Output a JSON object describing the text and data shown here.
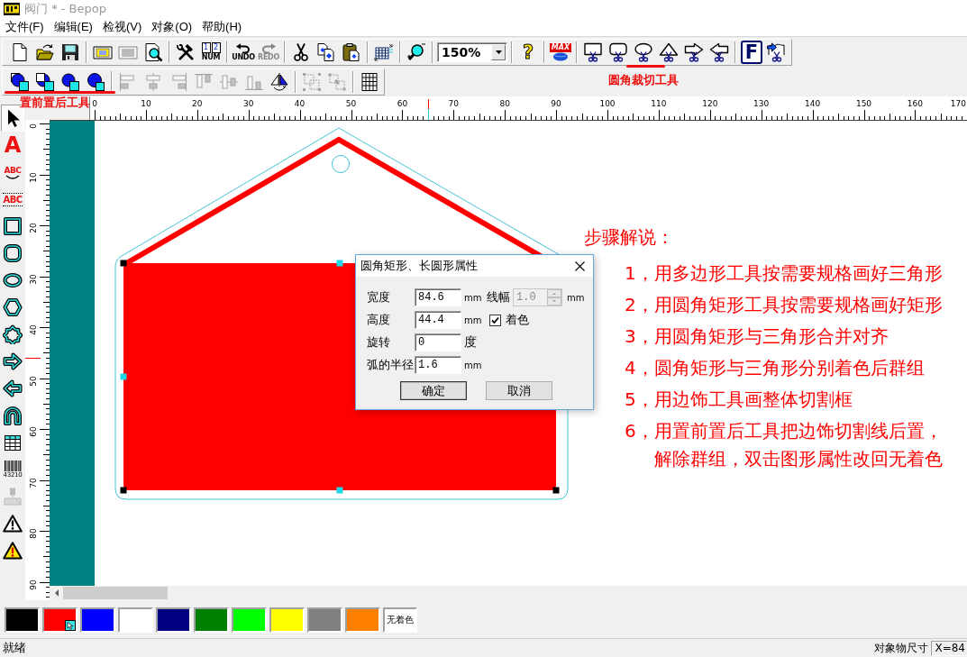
{
  "window": {
    "title": "阀门 * - Bepop"
  },
  "menu": [
    {
      "label": "文件(F)"
    },
    {
      "label": "编辑(E)"
    },
    {
      "label": "检视(V)"
    },
    {
      "label": "对象(O)"
    },
    {
      "label": "帮助(H)"
    }
  ],
  "toolbar_main": [
    [
      {
        "kind": "button",
        "disabled": false
      },
      {
        "kind": "button",
        "disabled": false
      },
      {
        "kind": "button",
        "disabled": false
      }
    ],
    [
      {
        "kind": "button",
        "disabled": false
      },
      {
        "kind": "button",
        "disabled": true
      },
      {
        "kind": "button",
        "disabled": false
      }
    ],
    [
      {
        "kind": "button",
        "disabled": false
      },
      {
        "kind": "button",
        "disabled": false,
        "digits": [
          "1",
          "2"
        ],
        "label": "NUM"
      }
    ],
    [
      {
        "kind": "button",
        "disabled": false,
        "label": "UNDO"
      },
      {
        "kind": "button",
        "disabled": true,
        "label": "REDO"
      }
    ],
    [
      {
        "kind": "button",
        "disabled": false
      },
      {
        "kind": "button",
        "disabled": false
      },
      {
        "kind": "button",
        "disabled": false
      }
    ],
    [
      {
        "kind": "button",
        "disabled": false
      }
    ],
    [
      {
        "kind": "button",
        "disabled": false
      }
    ],
    [
      {
        "kind": "combo",
        "value": "150%"
      }
    ],
    [
      {
        "kind": "button",
        "disabled": false,
        "label": "?"
      }
    ],
    [
      {
        "kind": "button",
        "disabled": false,
        "label": "MAX"
      }
    ],
    [
      {
        "kind": "button",
        "disabled": false
      },
      {
        "kind": "button",
        "disabled": false
      },
      {
        "kind": "button",
        "disabled": false
      },
      {
        "kind": "button",
        "disabled": false
      },
      {
        "kind": "button",
        "disabled": false
      },
      {
        "kind": "button",
        "disabled": false
      }
    ],
    [
      {
        "kind": "button",
        "disabled": false,
        "label": "F"
      },
      {
        "kind": "button",
        "disabled": false
      }
    ]
  ],
  "toolbar_arrange": [
    [
      {
        "disabled": false
      },
      {
        "disabled": false
      },
      {
        "disabled": false
      },
      {
        "disabled": false
      }
    ],
    [
      {
        "disabled": true
      },
      {
        "disabled": true
      },
      {
        "disabled": true
      },
      {
        "disabled": true
      },
      {
        "disabled": true
      },
      {
        "disabled": true
      },
      {
        "disabled": false
      }
    ],
    [
      {
        "disabled": true
      },
      {
        "disabled": true
      }
    ],
    [
      {
        "disabled": false
      }
    ]
  ],
  "annotations": [
    {
      "text": "置前置后工具"
    },
    {
      "text": "圆角裁切工具"
    }
  ],
  "tools": [
    {
      "selected": true,
      "disabled": false
    },
    {
      "label": "A",
      "selected": false,
      "disabled": false
    },
    {
      "label": "ABC",
      "selected": false,
      "disabled": false
    },
    {
      "label": "ABC",
      "selected": false,
      "disabled": false
    },
    {
      "selected": false,
      "disabled": false
    },
    {
      "selected": false,
      "disabled": false
    },
    {
      "selected": false,
      "disabled": false
    },
    {
      "selected": false,
      "disabled": false
    },
    {
      "selected": false,
      "disabled": false
    },
    {
      "selected": false,
      "disabled": false
    },
    {
      "selected": false,
      "disabled": false
    },
    {
      "selected": false,
      "disabled": false
    },
    {
      "selected": false,
      "disabled": false
    },
    {
      "label": "43210",
      "selected": false,
      "disabled": false
    },
    {
      "selected": false,
      "disabled": true
    },
    {
      "selected": false,
      "disabled": false
    },
    {
      "selected": false,
      "disabled": false
    }
  ],
  "ruler_horizontal": {
    "labels": [
      "0",
      "10",
      "20",
      "30",
      "40",
      "50",
      "60",
      "70",
      "80",
      "90",
      "100",
      "110",
      "120",
      "130",
      "140",
      "150",
      "160",
      "170"
    ]
  },
  "ruler_vertical": {
    "labels": [
      "0",
      "10",
      "20",
      "30",
      "40",
      "50",
      "60",
      "70",
      "80",
      "90"
    ]
  },
  "canvas": {
    "shape": {
      "selected": true
    },
    "notes": {
      "title": "步骤解说：",
      "steps": [
        {
          "number": "1，",
          "text": "用多边形工具按需要规格画好三角形"
        },
        {
          "number": "2，",
          "text": "用圆角矩形工具按需要规格画好矩形"
        },
        {
          "number": "3，",
          "text": "用圆角矩形与三角形合并对齐"
        },
        {
          "number": "4，",
          "text": "圆角矩形与三角形分别着色后群组"
        },
        {
          "number": "5，",
          "text": "用边饰工具画整体切割框"
        },
        {
          "number": "6，",
          "text": "用置前置后工具把边饰切割线后置，解除群组，双击图形属性改回无着色"
        }
      ]
    }
  },
  "dialog": {
    "title": "圆角矩形、长圆形属性",
    "fields": [
      {
        "label": "宽度",
        "value": "84.6",
        "unit": "mm"
      },
      {
        "label": "高度",
        "value": "44.4",
        "unit": "mm"
      },
      {
        "label": "旋转",
        "value": "0",
        "unit": "度"
      },
      {
        "label": "弧的半径",
        "value": "1.6",
        "unit": "mm"
      }
    ],
    "line_width": {
      "label": "线幅",
      "value": "1.0",
      "unit": "mm",
      "disabled": true
    },
    "fill": {
      "label": "着色",
      "checked": true
    },
    "buttons": [
      {
        "label": "确定",
        "default": true
      },
      {
        "label": "取消",
        "default": false
      }
    ]
  },
  "palette": [
    {
      "kind": "swatch",
      "color": "#000000",
      "selected": false
    },
    {
      "kind": "swatch",
      "color": "#ff0000",
      "selected": true
    },
    {
      "kind": "swatch",
      "color": "#0000ff",
      "selected": false
    },
    {
      "kind": "swatch",
      "color": "#ffffff",
      "selected": false
    },
    {
      "kind": "swatch",
      "color": "#000080",
      "selected": false
    },
    {
      "kind": "swatch",
      "color": "#008000",
      "selected": false
    },
    {
      "kind": "swatch",
      "color": "#00ff00",
      "selected": false
    },
    {
      "kind": "swatch",
      "color": "#ffff00",
      "selected": false
    },
    {
      "kind": "swatch",
      "color": "#808080",
      "selected": false
    },
    {
      "kind": "swatch",
      "color": "#ff8000",
      "selected": false
    },
    {
      "kind": "none",
      "label": "无着色",
      "selected": false
    }
  ],
  "status_bar": {
    "text": "就绪",
    "size_label": "对象物尺寸",
    "size_value": "X=84"
  }
}
